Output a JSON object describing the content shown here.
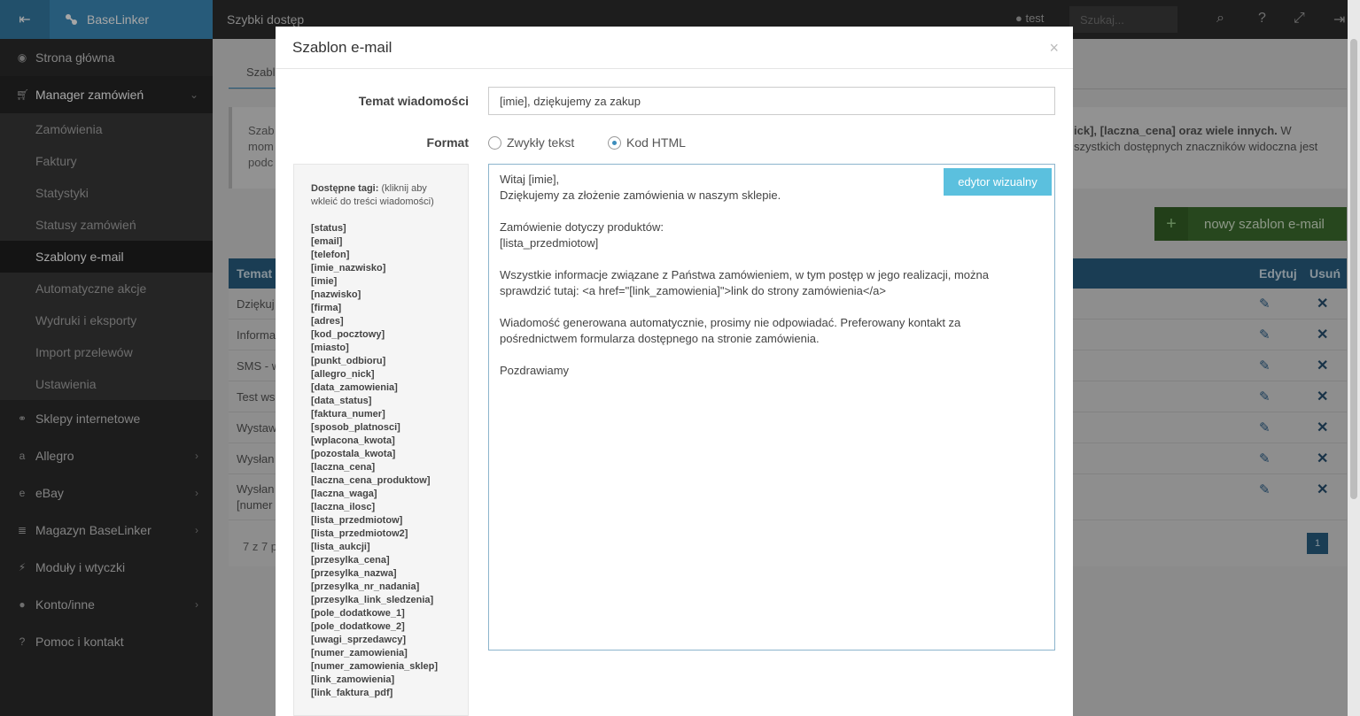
{
  "app": {
    "brand": "BaseLinker"
  },
  "topbar": {
    "quick_access": "Szybki dostęp",
    "user": "test",
    "search_placeholder": "Szukaj..."
  },
  "sidebar": {
    "items": [
      {
        "label": "Strona główna",
        "icon": "dashboard-icon"
      },
      {
        "label": "Manager zamówień",
        "icon": "cart-icon",
        "open": true
      },
      {
        "label": "Sklepy internetowe",
        "icon": "link-icon"
      },
      {
        "label": "Allegro",
        "icon": "allegro-icon"
      },
      {
        "label": "eBay",
        "icon": "ebay-icon"
      },
      {
        "label": "Magazyn BaseLinker",
        "icon": "database-icon"
      },
      {
        "label": "Moduły i wtyczki",
        "icon": "plug-icon"
      },
      {
        "label": "Konto/inne",
        "icon": "user-icon"
      },
      {
        "label": "Pomoc i kontakt",
        "icon": "question-icon"
      }
    ],
    "subitems": [
      "Zamówienia",
      "Faktury",
      "Statystyki",
      "Statusy zamówień",
      "Szablony e-mail",
      "Automatyczne akcje",
      "Wydruki i eksporty",
      "Import przelewów",
      "Ustawienia"
    ]
  },
  "page": {
    "tab": "Szablo",
    "info_left": [
      "Szab",
      "mom",
      "podc"
    ],
    "info_right_1": "ick], [laczna_cena] oraz wiele innych.",
    "info_right_1b": " W",
    "info_right_2": "szystkich dostępnych znaczników widoczna jest",
    "new_template_button": "nowy szablon e-mail",
    "table_headers": {
      "subject": "Temat",
      "edit": "Edytuj",
      "delete": "Usuń"
    },
    "rows": [
      "Dziękuj",
      "Informa",
      "SMS - w",
      "Test ws",
      "Wystaw",
      "Wysłan",
      "Wysłan"
    ],
    "row7_second_line": "[numer",
    "count_text": "7 z 7 p",
    "page_number": "1"
  },
  "modal": {
    "title": "Szablon e-mail",
    "close": "×",
    "subject_label": "Temat wiadomości",
    "subject_value": "[imie], dziękujemy za zakup",
    "format_label": "Format",
    "format_options": [
      "Zwykły tekst",
      "Kod HTML"
    ],
    "format_selected": "Kod HTML",
    "tags_header": "Dostępne tagi:",
    "tags_hint": " (kliknij aby wkleić do treści wiadomości)",
    "tags": [
      "[status]",
      "[email]",
      "[telefon]",
      "[imie_nazwisko]",
      "[imie]",
      "[nazwisko]",
      "[firma]",
      "[adres]",
      "[kod_pocztowy]",
      "[miasto]",
      "[punkt_odbioru]",
      "[allegro_nick]",
      "[data_zamowienia]",
      "[data_status]",
      "[faktura_numer]",
      "[sposob_platnosci]",
      "[wplacona_kwota]",
      "[pozostala_kwota]",
      "[laczna_cena]",
      "[laczna_cena_produktow]",
      "[laczna_waga]",
      "[laczna_ilosc]",
      "[lista_przedmiotow]",
      "[lista_przedmiotow2]",
      "[lista_aukcji]",
      "[przesylka_cena]",
      "[przesylka_nazwa]",
      "[przesylka_nr_nadania]",
      "[przesylka_link_sledzenia]",
      "[pole_dodatkowe_1]",
      "[pole_dodatkowe_2]",
      "[uwagi_sprzedawcy]",
      "[numer_zamowienia]",
      "[numer_zamowienia_sklep]",
      "[link_zamowienia]",
      "[link_faktura_pdf]"
    ],
    "visual_editor_button": "edytor wizualny",
    "body": "Witaj [imie],\nDziękujemy za złożenie zamówienia w naszym sklepie.\n\nZamówienie dotyczy produktów:\n[lista_przedmiotow]\n\nWszystkie informacje związane z Państwa zamówieniem, w tym postęp w jego realizacji, można\nsprawdzić tutaj: <a href=\"[link_zamowienia]\">link do strony zamówienia</a>\n\nWiadomość generowana automatycznie, prosimy nie odpowiadać. Preferowany kontakt za\npośrednictwem formularza dostępnego na stronie zamówienia.\n\nPozdrawiamy"
  }
}
